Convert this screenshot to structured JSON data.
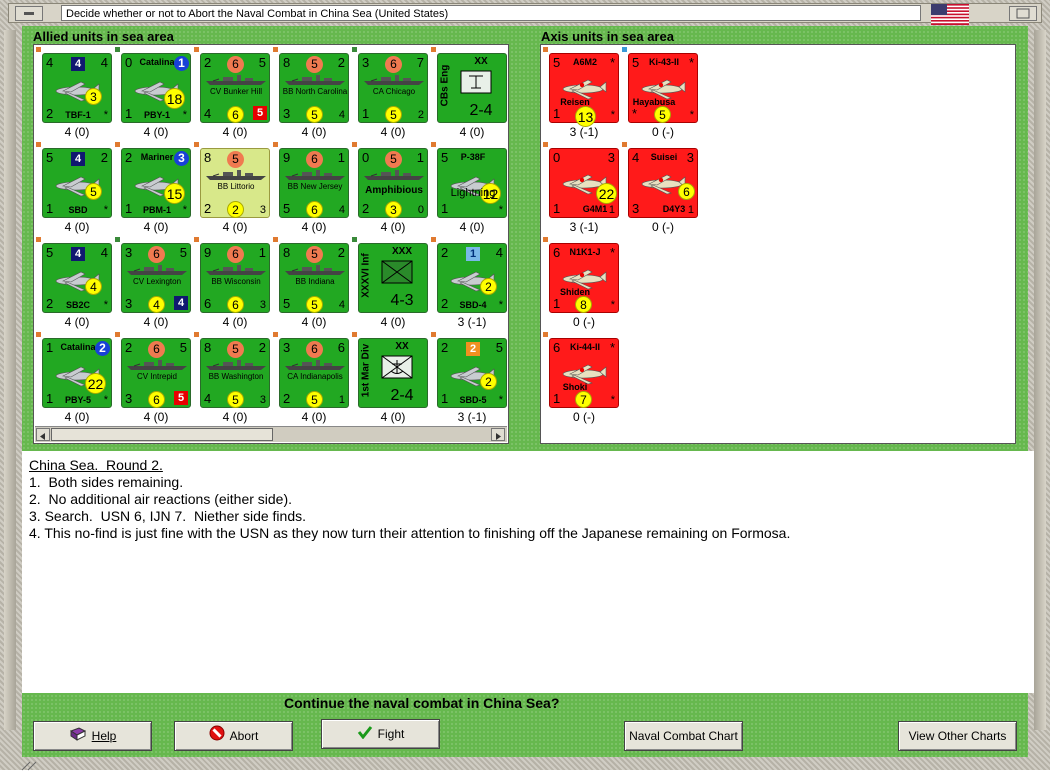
{
  "window": {
    "title": "Decide whether or not to Abort the Naval Combat in China Sea (United States)"
  },
  "allied": {
    "label": "Allied units in sea area"
  },
  "axis": {
    "label": "Axis units in sea area"
  },
  "log": {
    "title": "China Sea.  Round 2.",
    "lines": [
      "1.  Both sides remaining.",
      "2.  No additional air reactions (either side).",
      "3. Search.  USN 6, IJN 7.  Niether side finds.",
      "4. This no-find is just fine with the USN as they now turn their attention to finishing off the Japanese remaining on Formosa."
    ]
  },
  "prompt": "Continue the naval combat in China Sea?",
  "buttons": {
    "help": "Help",
    "abort": "Abort",
    "fight": "Fight",
    "naval_chart": "Naval Combat Chart",
    "other_charts": "View Other Charts"
  },
  "colors": {
    "green_counter": "#22a822",
    "red_counter": "#ff1a1a",
    "selected_counter": "#d8e88a",
    "background_green": "#66b84e"
  },
  "allied_units": {
    "r1": [
      {
        "tl": "4",
        "tr": "4",
        "bl": "2",
        "br": "*",
        "name": "TBF-1",
        "badge": "4",
        "circle": "3",
        "count": "4 (0)"
      },
      {
        "tl": "0",
        "tr": "",
        "bl": "1",
        "br": "*",
        "name": "PBY-1",
        "top": "Catalina",
        "badge": "1",
        "circle": "18",
        "count": "4 (0)"
      },
      {
        "tl": "2",
        "tr": "5",
        "bl": "4",
        "br": "",
        "name": "CV Bunker Hill",
        "circle_top": "6",
        "circle_bot": "6",
        "sq": "5",
        "bot_r": "",
        "count": "4 (0)"
      },
      {
        "tl": "8",
        "tr": "2",
        "bl": "3",
        "br": "4",
        "name": "BB North Carolina",
        "circle_top": "5",
        "circle_bot": "5",
        "count": "4 (0)"
      },
      {
        "tl": "3",
        "tr": "7",
        "bl": "1",
        "br": "2",
        "name": "CA Chicago",
        "circle_top": "6",
        "circle_bot": "5",
        "count": "4 (0)"
      },
      {
        "top": "XX",
        "side": "CBs Eng",
        "bot": "2-4",
        "count": "4 (0)"
      }
    ],
    "r2": [
      {
        "tl": "5",
        "tr": "2",
        "bl": "1",
        "br": "*",
        "name": "SBD",
        "badge": "4",
        "circle": "5",
        "count": "4 (0)"
      },
      {
        "tl": "2",
        "bl": "1",
        "br": "*",
        "name": "PBM-1",
        "top": "Mariner",
        "badge": "3",
        "circle": "15",
        "count": "4 (0)"
      },
      {
        "tl": "8",
        "tr": "",
        "bl": "2",
        "br": "3",
        "name": "BB Littorio",
        "circle_top": "5",
        "circle_bot": "2",
        "count": "4 (0)"
      },
      {
        "tl": "9",
        "tr": "1",
        "bl": "5",
        "br": "4",
        "name": "BB New Jersey",
        "circle_top": "6",
        "circle_bot": "6",
        "count": "4 (0)"
      },
      {
        "tl": "0",
        "tr": "1",
        "bl": "2",
        "br": "0",
        "name": "Amphibious",
        "circle_top": "5",
        "circle_bot": "3",
        "count": "4 (0)"
      },
      {
        "tl": "5",
        "bl": "1",
        "br": "*",
        "name": "Lightning",
        "top": "P-38F",
        "circle": "12",
        "count": "4 (0)"
      }
    ],
    "r3": [
      {
        "tl": "5",
        "tr": "4",
        "bl": "2",
        "br": "*",
        "name": "SB2C",
        "badge": "4",
        "circle": "4",
        "count": "4 (0)"
      },
      {
        "tl": "3",
        "tr": "5",
        "bl": "3",
        "br": "",
        "name": "CV Lexington",
        "circle_top": "6",
        "circle_bot": "4",
        "sq": "4",
        "count": "4 (0)"
      },
      {
        "tl": "9",
        "tr": "1",
        "bl": "6",
        "br": "3",
        "name": "BB Wisconsin",
        "circle_top": "6",
        "circle_bot": "6",
        "count": "4 (0)"
      },
      {
        "tl": "8",
        "tr": "2",
        "bl": "5",
        "br": "4",
        "name": "BB Indiana",
        "circle_top": "5",
        "circle_bot": "5",
        "count": "4 (0)"
      },
      {
        "top": "XXX",
        "side": "XXXVI Inf",
        "bot": "4-3",
        "count": "4 (0)"
      },
      {
        "tl": "2",
        "tr": "4",
        "bl": "2",
        "br": "*",
        "name": "SBD-4",
        "badge": "1",
        "circle": "2",
        "count": "3 (-1)"
      }
    ],
    "r4": [
      {
        "tl": "1",
        "bl": "1",
        "br": "*",
        "name": "PBY-5",
        "top": "Catalina",
        "badge": "2",
        "circle": "22",
        "count": "4 (0)"
      },
      {
        "tl": "2",
        "tr": "5",
        "bl": "3",
        "br": "",
        "name": "CV Intrepid",
        "circle_top": "6",
        "circle_bot": "6",
        "sq": "5",
        "count": "4 (0)"
      },
      {
        "tl": "8",
        "tr": "2",
        "bl": "4",
        "br": "3",
        "name": "BB Washington",
        "circle_top": "5",
        "circle_bot": "5",
        "count": "4 (0)"
      },
      {
        "tl": "3",
        "tr": "6",
        "bl": "2",
        "br": "1",
        "name": "CA Indianapolis",
        "circle_top": "6",
        "circle_bot": "5",
        "count": "4 (0)"
      },
      {
        "top": "XX",
        "side": "1st Mar Div",
        "bot": "2-4",
        "count": "4 (0)"
      },
      {
        "tl": "2",
        "tr": "5",
        "bl": "1",
        "br": "*",
        "name": "SBD-5",
        "badge": "2",
        "circle": "2",
        "count": "3 (-1)"
      }
    ]
  },
  "axis_units": [
    {
      "tl": "5",
      "tr": "*",
      "bl": "1",
      "br": "*",
      "top": "A6M2",
      "name": "Reisen",
      "circle": "13",
      "count": "3 (-1)"
    },
    {
      "tl": "5",
      "tr": "*",
      "bl": "*",
      "br": "*",
      "top": "Ki-43-II",
      "name": "Hayabusa",
      "circle": "5",
      "count": "0 (-)"
    },
    {
      "tl": "0",
      "tr": "3",
      "bl": "1",
      "br": "1",
      "name": "G4M1",
      "circle": "22",
      "count": "3 (-1)"
    },
    {
      "tl": "4",
      "tr": "3",
      "bl": "3",
      "br": "1",
      "top": "Suisei",
      "name": "D4Y3",
      "circle": "6",
      "count": "0 (-)"
    },
    {
      "tl": "6",
      "tr": "*",
      "bl": "1",
      "br": "*",
      "top": "N1K1-J",
      "name": "Shiden",
      "circle": "8",
      "count": "0 (-)"
    },
    {
      "tl": "6",
      "tr": "*",
      "bl": "1",
      "br": "*",
      "top": "Ki-44-II",
      "name": "Shoki",
      "circle": "7",
      "count": "0 (-)"
    }
  ]
}
